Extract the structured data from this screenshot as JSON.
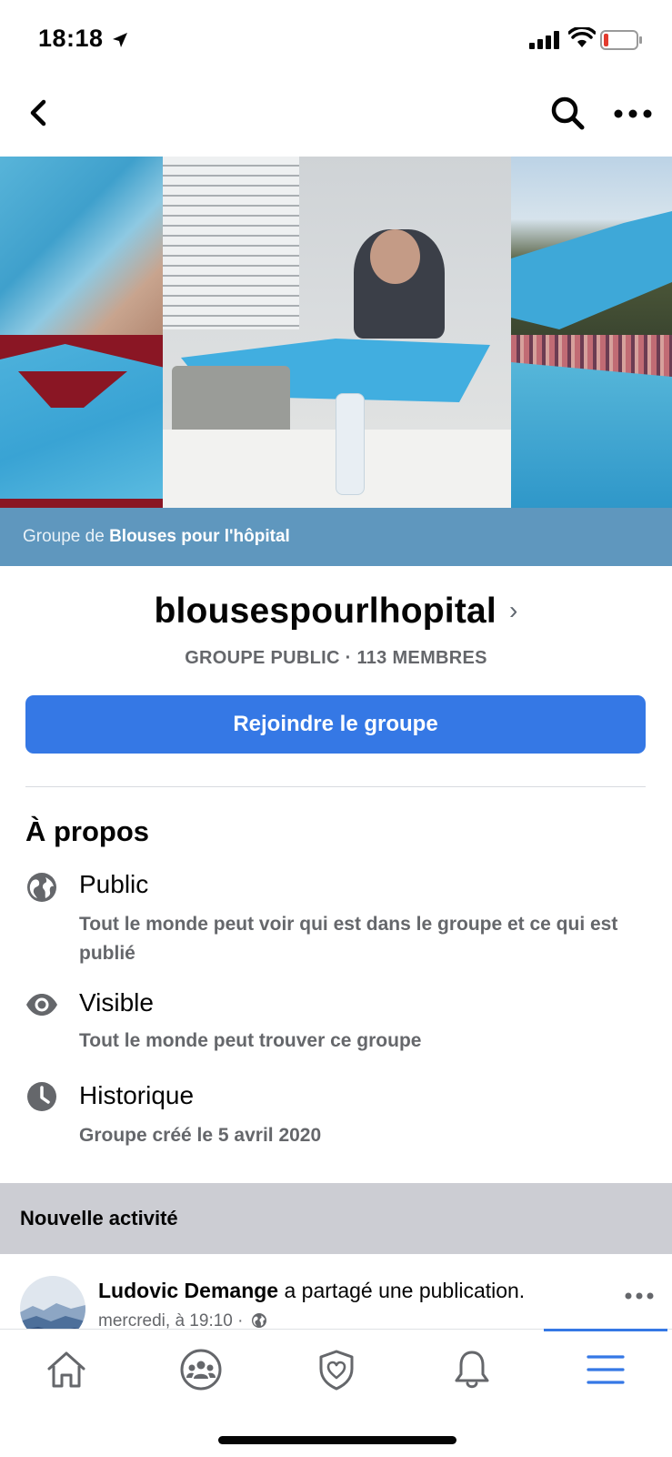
{
  "status_bar": {
    "time": "18:18"
  },
  "cover": {
    "caption_prefix": "Groupe de",
    "caption_name": "Blouses pour l'hôpital"
  },
  "group": {
    "name": "blousespourlhopital",
    "chevron": "›",
    "meta": "GROUPE PUBLIC · 113 MEMBRES",
    "join_label": "Rejoindre le groupe"
  },
  "about": {
    "title": "À propos",
    "items": [
      {
        "icon": "globe-icon",
        "heading": "Public",
        "sub": "Tout le monde peut voir qui est dans le groupe et ce qui est publié"
      },
      {
        "icon": "eye-icon",
        "heading": "Visible",
        "sub": "Tout le monde peut trouver ce groupe"
      },
      {
        "icon": "clock-icon",
        "heading": "Historique",
        "sub": "Groupe créé le 5 avril 2020"
      }
    ]
  },
  "activity": {
    "label": "Nouvelle activité",
    "post": {
      "author": "Ludovic Demange",
      "action": "a partagé une publication.",
      "time": "mercredi, à 19:10 ·"
    }
  },
  "tabs": [
    {
      "icon": "home-icon",
      "active": false
    },
    {
      "icon": "groups-icon",
      "active": false
    },
    {
      "icon": "shield-heart-icon",
      "active": false
    },
    {
      "icon": "bell-icon",
      "active": false
    },
    {
      "icon": "menu-icon",
      "active": true
    }
  ],
  "colors": {
    "accent": "#3578e5",
    "caption_band": "#5f97be",
    "secondary_text": "#65676b"
  }
}
